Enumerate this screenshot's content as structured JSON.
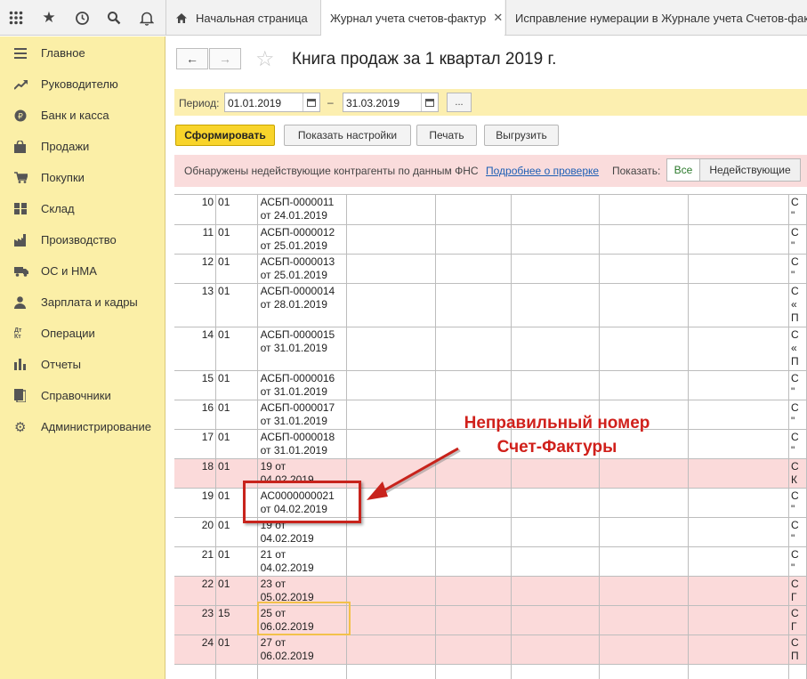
{
  "topbar": {
    "icons": [
      "apps-grid-icon",
      "star-icon",
      "history-icon",
      "search-icon",
      "bell-icon"
    ],
    "tabs": [
      {
        "label": "Начальная страница"
      },
      {
        "label": "Журнал учета счетов-фактур"
      },
      {
        "label": "Исправление нумерации в Журнале учета Счетов-фактур"
      }
    ],
    "close_glyph": "✕"
  },
  "sidebar": {
    "items": [
      {
        "label": "Главное",
        "icon": "menu-icon"
      },
      {
        "label": "Руководителю",
        "icon": "trend-icon"
      },
      {
        "label": "Банк и касса",
        "icon": "coin-icon"
      },
      {
        "label": "Продажи",
        "icon": "bag-icon"
      },
      {
        "label": "Покупки",
        "icon": "cart-icon"
      },
      {
        "label": "Склад",
        "icon": "warehouse-icon"
      },
      {
        "label": "Производство",
        "icon": "factory-icon"
      },
      {
        "label": "ОС и НМА",
        "icon": "truck-icon"
      },
      {
        "label": "Зарплата и кадры",
        "icon": "person-icon"
      },
      {
        "label": "Операции",
        "icon": "debit-credit-icon"
      },
      {
        "label": "Отчеты",
        "icon": "bar-chart-icon"
      },
      {
        "label": "Справочники",
        "icon": "book-icon"
      },
      {
        "label": "Администрирование",
        "icon": "gear-icon"
      }
    ],
    "dtkt": "Дт Кт"
  },
  "header": {
    "title": "Книга продаж за 1 квартал 2019 г.",
    "back_glyph": "←",
    "forward_glyph": "→",
    "star_glyph": "☆"
  },
  "period": {
    "label": "Период:",
    "from": "01.01.2019",
    "to": "31.03.2019",
    "dash": "–",
    "dots": "..."
  },
  "commands": {
    "generate": "Сформировать",
    "settings": "Показать настройки",
    "print": "Печать",
    "export": "Выгрузить"
  },
  "warning": {
    "text": "Обнаружены недействующие контрагенты по данным ФНС",
    "link": "Подробнее о проверке",
    "show_label": "Показать:",
    "all": "Все",
    "inactive": "Недействующие"
  },
  "table": {
    "rows": [
      {
        "n": "10",
        "code": "01",
        "inv1": "АСБП-0000011",
        "inv2": "от 24.01.2019",
        "edge": [
          "С",
          "\""
        ],
        "pink": false
      },
      {
        "n": "11",
        "code": "01",
        "inv1": "АСБП-0000012",
        "inv2": "от 25.01.2019",
        "edge": [
          "С",
          "\""
        ],
        "pink": false
      },
      {
        "n": "12",
        "code": "01",
        "inv1": "АСБП-0000013",
        "inv2": "от 25.01.2019",
        "edge": [
          "С",
          "\""
        ],
        "pink": false
      },
      {
        "n": "13",
        "code": "01",
        "inv1": "АСБП-0000014",
        "inv2": "от 28.01.2019",
        "edge": [
          "С",
          "«",
          "П"
        ],
        "pink": false
      },
      {
        "n": "14",
        "code": "01",
        "inv1": "АСБП-0000015",
        "inv2": "от 31.01.2019",
        "edge": [
          "С",
          "«",
          "П"
        ],
        "pink": false
      },
      {
        "n": "15",
        "code": "01",
        "inv1": "АСБП-0000016",
        "inv2": "от 31.01.2019",
        "edge": [
          "С",
          "\""
        ],
        "pink": false
      },
      {
        "n": "16",
        "code": "01",
        "inv1": "АСБП-0000017",
        "inv2": "от 31.01.2019",
        "edge": [
          "С",
          "\""
        ],
        "pink": false
      },
      {
        "n": "17",
        "code": "01",
        "inv1": "АСБП-0000018",
        "inv2": "от 31.01.2019",
        "edge": [
          "С",
          "\""
        ],
        "pink": false
      },
      {
        "n": "18",
        "code": "01",
        "inv1": "19 от",
        "inv2": "04.02.2019",
        "edge": [
          "С",
          "К"
        ],
        "pink": true
      },
      {
        "n": "19",
        "code": "01",
        "inv1": "АС0000000021",
        "inv2": "от 04.02.2019",
        "edge": [
          "С",
          "\""
        ],
        "pink": false
      },
      {
        "n": "20",
        "code": "01",
        "inv1": "19 от",
        "inv2": "04.02.2019",
        "edge": [
          "С",
          "\""
        ],
        "pink": false
      },
      {
        "n": "21",
        "code": "01",
        "inv1": "21 от",
        "inv2": "04.02.2019",
        "edge": [
          "С",
          "\""
        ],
        "pink": false
      },
      {
        "n": "22",
        "code": "01",
        "inv1": "23 от",
        "inv2": "05.02.2019",
        "edge": [
          "С",
          "Г"
        ],
        "pink": true
      },
      {
        "n": "23",
        "code": "15",
        "inv1": "25 от",
        "inv2": "06.02.2019",
        "edge": [
          "С",
          "Г"
        ],
        "pink": true
      },
      {
        "n": "24",
        "code": "01",
        "inv1": "27 от",
        "inv2": "06.02.2019",
        "edge": [
          "С",
          "П"
        ],
        "pink": true
      }
    ]
  },
  "annotation": {
    "line1": "Неправильный номер",
    "line2": "Счет-Фактуры"
  },
  "colors": {
    "sidebar_bg": "#fbefa7",
    "accent_yellow": "#f8d42b",
    "row_pink": "#fbdada",
    "annotation_red": "#d0201b"
  }
}
